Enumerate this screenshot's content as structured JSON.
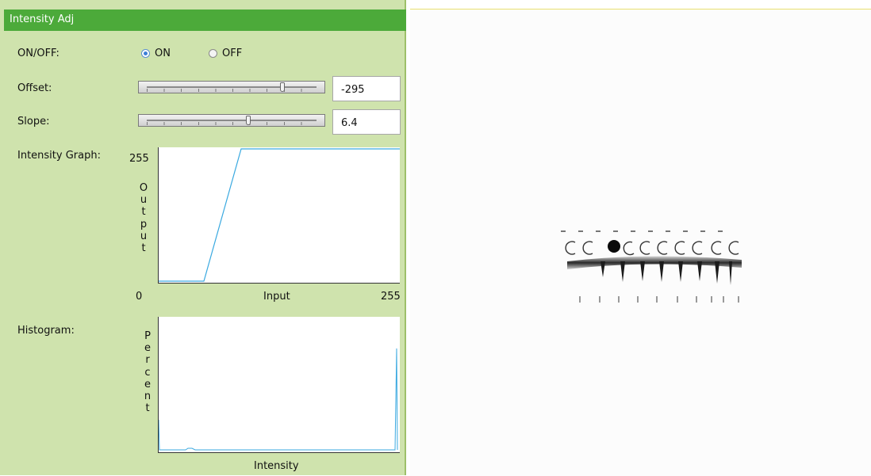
{
  "panel": {
    "title": "Intensity Adj",
    "on_off_label": "ON/OFF:",
    "on_label": "ON",
    "off_label": "OFF",
    "on_selected": true,
    "offset_label": "Offset:",
    "offset_value": "-295",
    "offset_position": 0.8,
    "slope_label": "Slope:",
    "slope_value": "6.4",
    "slope_position": 0.6
  },
  "intensity_graph": {
    "label": "Intensity Graph:",
    "y_max": "255",
    "y_title": "Output",
    "x_min": "0",
    "x_title": "Input",
    "x_max": "255",
    "line_color": "#3aa9e0"
  },
  "histogram": {
    "label": "Histogram:",
    "y_title": "Percent",
    "x_title": "Intensity",
    "line_color": "#3aa9e0"
  },
  "colors": {
    "panel_bg": "#cfe3ad",
    "titlebar": "#4caa3a",
    "viewer_border": "#e8e070"
  }
}
